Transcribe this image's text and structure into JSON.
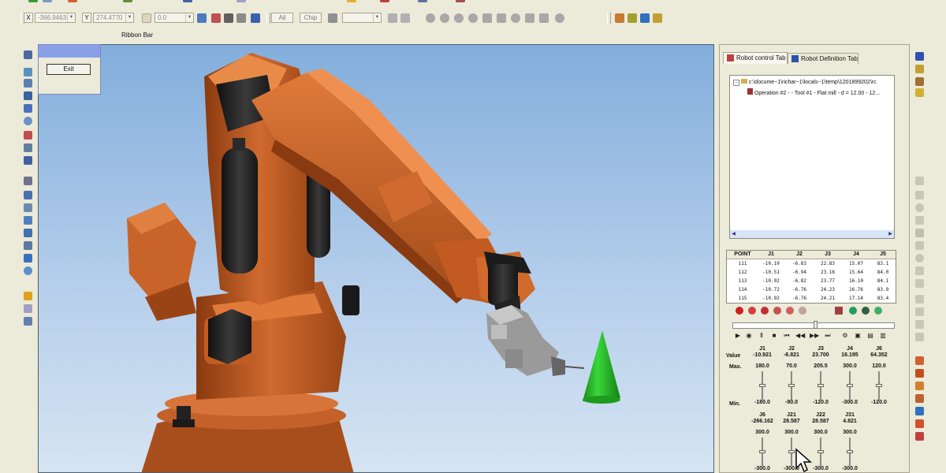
{
  "toolbar": {
    "row1_partial": true,
    "fields": {
      "x_label": "X",
      "x_value": "-366.9463",
      "y_label": "Y",
      "y_value": "274.4770",
      "z_value": "0.0",
      "all_label": "All",
      "chip_label": "Chip"
    },
    "ribbon_label": "Ribbon Bar"
  },
  "exit_panel": {
    "exit_label": "Exit"
  },
  "right_panel": {
    "tabs": [
      {
        "label": "Robot control Tab",
        "active": true
      },
      {
        "label": "Robot Definition Tab",
        "active": false
      }
    ],
    "tree": {
      "root": "c:\\docume~1\\richar~1\\locals~1\\temp\\1201899202\\rc",
      "operation": "Operation #2 -   - Tool #1 - Flat mill - d = 12.00 - 12..."
    },
    "point_table": {
      "columns": [
        "POINT",
        "J1",
        "J2",
        "J3",
        "J4",
        "J5"
      ],
      "rows": [
        [
          "111",
          "-10.10",
          "-6.83",
          "22.83",
          "15.07",
          "83.1"
        ],
        [
          "112",
          "-10.51",
          "-6.94",
          "23.16",
          "15.64",
          "84.0"
        ],
        [
          "113",
          "-10.92",
          "-6.82",
          "23.77",
          "16.10",
          "84.1"
        ],
        [
          "114",
          "-10.72",
          "-6.76",
          "24.23",
          "16.76",
          "83.9"
        ],
        [
          "115",
          "-10.92",
          "-6.76",
          "24.21",
          "17.14",
          "83.4"
        ]
      ]
    },
    "joints": {
      "value_label": "Value",
      "max_label": "Max.",
      "min_label": "Min.",
      "row1": [
        {
          "name": "J1",
          "value": "-10.921",
          "max": "180.0",
          "min": "-180.0"
        },
        {
          "name": "J2",
          "value": "-6.821",
          "max": "70.0",
          "min": "-90.0"
        },
        {
          "name": "J3",
          "value": "23.700",
          "max": "205.5",
          "min": "-120.0"
        },
        {
          "name": "J4",
          "value": "16.195",
          "max": "300.0",
          "min": "-300.0"
        },
        {
          "name": "J6",
          "value": "64.352",
          "max": "120.0",
          "min": "-120.0"
        }
      ],
      "row2": [
        {
          "name": "J6",
          "value": "-266.162",
          "max": "300.0",
          "min": "-300.0"
        },
        {
          "name": "J21",
          "value": "28.587",
          "max": "300.0",
          "min": "-300.0"
        },
        {
          "name": "J22",
          "value": "28.587",
          "max": "300.0",
          "min": "-300.0"
        },
        {
          "name": "J31",
          "value": "4.821",
          "max": "300.0",
          "min": "-300.0"
        }
      ]
    }
  },
  "colors": {
    "robot": "#c8642a",
    "tool_cone": "#22b422",
    "viewport_top": "#83aedc",
    "panel_bg": "#ecead8"
  }
}
